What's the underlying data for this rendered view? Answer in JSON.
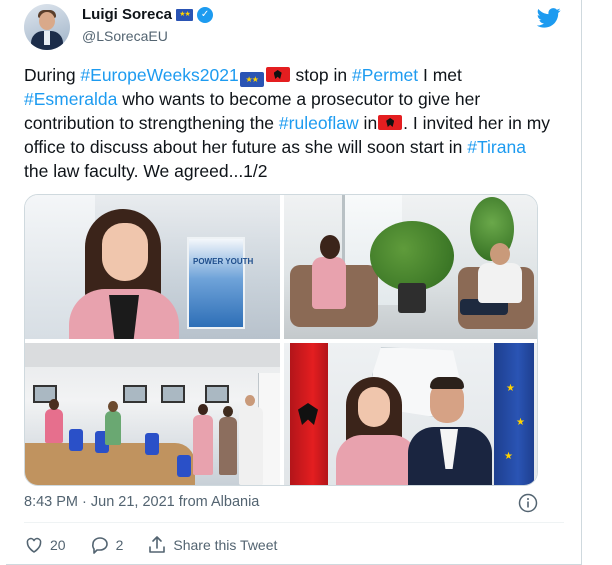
{
  "author": {
    "display_name": "Luigi Soreca",
    "handle": "@LSorecaEU",
    "verified": true,
    "avatar_icon": "profile-photo-avatar",
    "name_badge_icon": "eu-flag-emoji"
  },
  "tweet": {
    "segments": [
      {
        "text": "During ",
        "type": "text"
      },
      {
        "text": "#EuropeWeeks2021",
        "type": "hashtag"
      },
      {
        "text": "",
        "type": "emoji",
        "emoji": "eu-flag"
      },
      {
        "text": "",
        "type": "emoji",
        "emoji": "albania-flag"
      },
      {
        "text": " stop in ",
        "type": "text"
      },
      {
        "text": "#Permet",
        "type": "hashtag"
      },
      {
        "text": " I met ",
        "type": "text"
      },
      {
        "text": "#Esmeralda",
        "type": "hashtag"
      },
      {
        "text": " who wants to become a prosecutor to give her contribution to strengthening the ",
        "type": "text"
      },
      {
        "text": "#ruleoflaw",
        "type": "hashtag"
      },
      {
        "text": " in",
        "type": "text"
      },
      {
        "text": "",
        "type": "emoji",
        "emoji": "albania-flag"
      },
      {
        "text": ". I invited her in my office to discuss about her future as she will soon start in ",
        "type": "text"
      },
      {
        "text": "#Tirana",
        "type": "hashtag"
      },
      {
        "text": " the law faculty. We agreed...1/2",
        "type": "text"
      }
    ],
    "photo_count": 4,
    "poster_text": "POWER YOUTH"
  },
  "meta": {
    "timestamp": "8:43 PM · Jun 21, 2021 from Albania",
    "info_icon": "info-circle-icon"
  },
  "actions": {
    "like_count": "20",
    "reply_count": "2",
    "share_label": "Share this Tweet"
  },
  "colors": {
    "link": "#1d9bf0",
    "text": "#0f1419",
    "muted": "#536471",
    "twitter_blue": "#1d9bf0"
  }
}
